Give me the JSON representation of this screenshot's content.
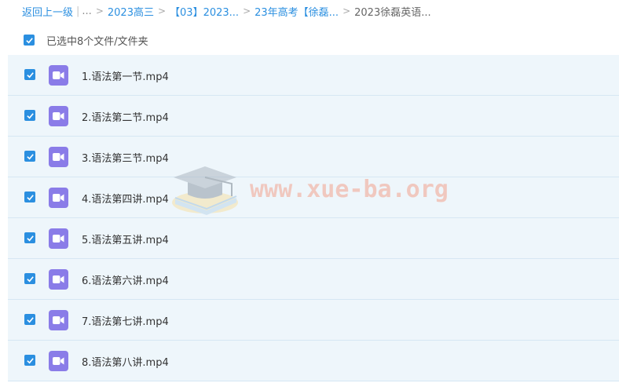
{
  "breadcrumb": {
    "back": "返回上一级",
    "bar": "|",
    "ellipsis": "...",
    "sep": ">",
    "items": [
      "2023高三",
      "【03】2023...",
      "23年高考【徐磊...",
      "2023徐磊英语..."
    ]
  },
  "selection": {
    "label": "已选中8个文件/文件夹",
    "checked": true
  },
  "files": [
    {
      "name": "1.语法第一节.mp4",
      "checked": true
    },
    {
      "name": "2.语法第二节.mp4",
      "checked": true
    },
    {
      "name": "3.语法第三节.mp4",
      "checked": true
    },
    {
      "name": "4.语法第四讲.mp4",
      "checked": true
    },
    {
      "name": "5.语法第五讲.mp4",
      "checked": true
    },
    {
      "name": "6.语法第六讲.mp4",
      "checked": true
    },
    {
      "name": "7.语法第七讲.mp4",
      "checked": true
    },
    {
      "name": "8.语法第八讲.mp4",
      "checked": true
    }
  ],
  "watermark": {
    "text": "www.xue-ba.org",
    "icon": "graduation-cap-icon"
  },
  "colors": {
    "accent": "#2b8fe0",
    "row_bg": "#eef6fb",
    "video_icon": "#8a7ce8",
    "watermark": "#f2a38f"
  }
}
